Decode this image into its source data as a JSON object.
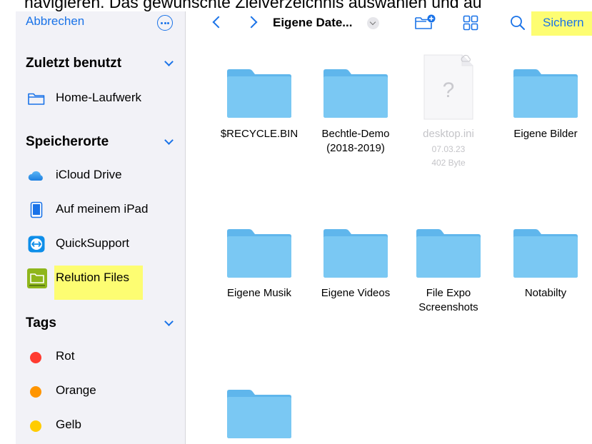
{
  "caption": "navigieren. Das gewünschte Zielverzeichnis auswählen und au",
  "sidebar": {
    "cancel_label": "Abbrechen",
    "more_icon": "ellipsis-circle-icon",
    "recent": {
      "title": "Zuletzt benutzt",
      "items": [
        {
          "label": "Home-Laufwerk",
          "icon": "folder-outline-icon"
        }
      ]
    },
    "locations": {
      "title": "Speicherorte",
      "items": [
        {
          "label": "iCloud Drive",
          "icon": "icloud-icon"
        },
        {
          "label": "Auf meinem iPad",
          "icon": "ipad-icon"
        },
        {
          "label": "QuickSupport",
          "icon": "quicksupport-icon"
        },
        {
          "label": "Relution Files",
          "icon": "relution-icon"
        }
      ]
    },
    "tags": {
      "title": "Tags",
      "items": [
        {
          "label": "Rot",
          "color": "#ff3b30"
        },
        {
          "label": "Orange",
          "color": "#ff9500"
        },
        {
          "label": "Gelb",
          "color": "#ffcc00"
        }
      ]
    }
  },
  "toolbar": {
    "title": "Eigene Date...",
    "save_label": "Sichern",
    "icons": [
      "back-icon",
      "forward-icon",
      "new-folder-icon",
      "grid-view-icon",
      "search-icon"
    ]
  },
  "files": [
    {
      "name": "$RECYCLE.BIN",
      "type": "folder"
    },
    {
      "name": "Bechtle-Demo (2018-2019)",
      "type": "folder"
    },
    {
      "name": "desktop.ini",
      "type": "file",
      "date": "07.03.23",
      "size": "402 Byte"
    },
    {
      "name": "Eigene Bilder",
      "type": "folder"
    },
    {
      "name": "Eigene Musik",
      "type": "folder"
    },
    {
      "name": "Eigene Videos",
      "type": "folder"
    },
    {
      "name": "File Expo Screenshots",
      "type": "folder"
    },
    {
      "name": "Notabilty",
      "type": "folder"
    },
    {
      "name": "",
      "type": "folder"
    }
  ],
  "colors": {
    "accent": "#1a73e8",
    "folder": "#74c3f0",
    "highlight": "#fdfd72"
  }
}
